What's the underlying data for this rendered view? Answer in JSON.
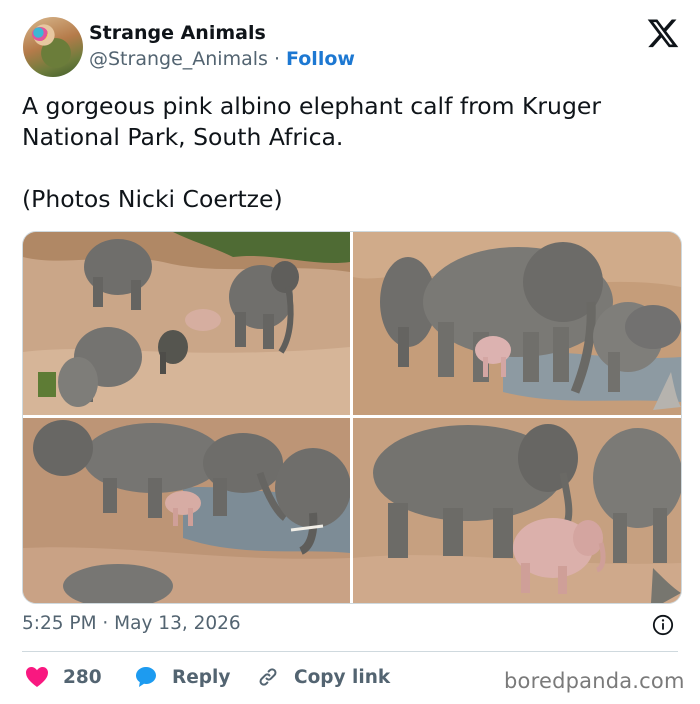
{
  "author": {
    "display_name": "Strange Animals",
    "handle": "@Strange_Animals",
    "separator": "·",
    "follow_label": "Follow"
  },
  "tweet": {
    "text_line1": "A gorgeous pink albino elephant calf from Kruger National Park, South Africa.",
    "text_line2": "(Photos Nicki Coertze)"
  },
  "timestamp": "5:25 PM · May 13, 2026",
  "actions": {
    "like_count": "280",
    "reply_label": "Reply",
    "copy_link_label": "Copy link"
  },
  "icons": {
    "brand": "x-logo-icon",
    "like": "heart-icon",
    "reply": "speech-bubble-icon",
    "copy": "link-icon",
    "info": "info-icon"
  },
  "colors": {
    "follow": "#1d78d2",
    "like": "#f91880",
    "reply": "#1d9bf0",
    "muted": "#536471"
  },
  "watermark": "boredpanda.com"
}
